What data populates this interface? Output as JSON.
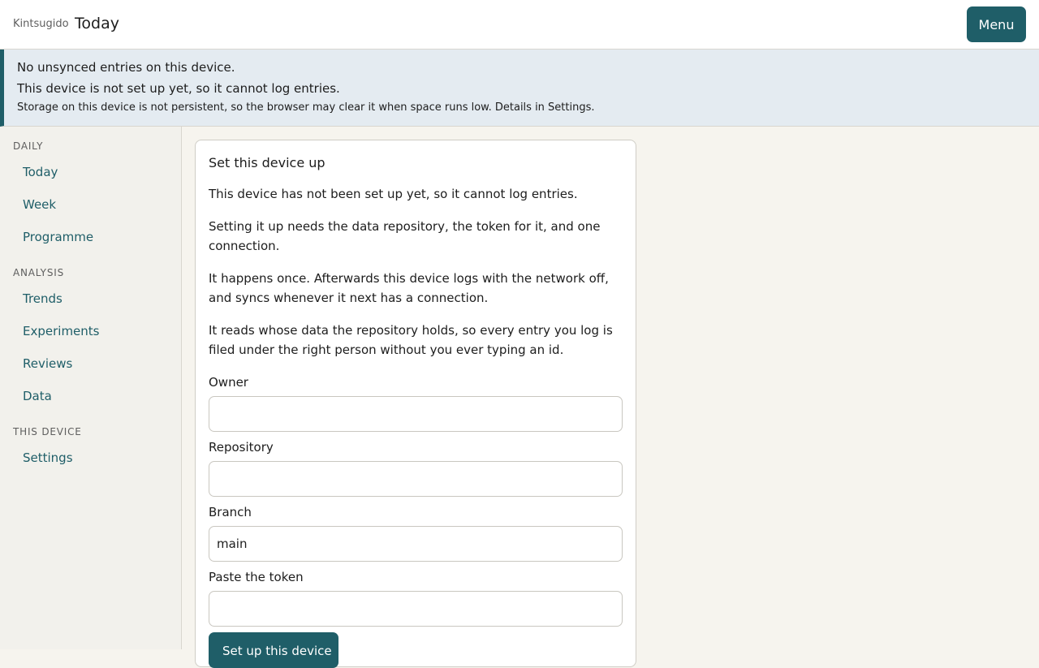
{
  "header": {
    "brand": "Kintsugido",
    "title": "Today",
    "menu_label": "Menu"
  },
  "banner": {
    "sync_status": "No unsynced entries on this device.",
    "setup_status": "This device is not set up yet, so it cannot log entries.",
    "storage_note": "Storage on this device is not persistent, so the browser may clear it when space runs low. Details in Settings."
  },
  "sidebar": {
    "sections": [
      {
        "label": "DAILY",
        "items": [
          "Today",
          "Week",
          "Programme"
        ]
      },
      {
        "label": "ANALYSIS",
        "items": [
          "Trends",
          "Experiments",
          "Reviews",
          "Data"
        ]
      },
      {
        "label": "THIS DEVICE",
        "items": [
          "Settings"
        ]
      }
    ]
  },
  "setup": {
    "title": "Set this device up",
    "paragraphs": [
      "This device has not been set up yet, so it cannot log entries.",
      "Setting it up needs the data repository, the token for it, and one connection.",
      "It happens once. Afterwards this device logs with the network off, and syncs whenever it next has a connection.",
      "It reads whose data the repository holds, so every entry you log is filed under the right person without you ever typing an id."
    ],
    "fields": {
      "owner": {
        "label": "Owner",
        "value": ""
      },
      "repository": {
        "label": "Repository",
        "value": ""
      },
      "branch": {
        "label": "Branch",
        "value": "main"
      },
      "token": {
        "label": "Paste the token",
        "value": ""
      }
    },
    "submit_label": "Set up this device"
  },
  "colors": {
    "accent": "#1f5e68",
    "banner_bg": "#e4ebf1",
    "page_bg": "#f6f4ee",
    "sidebar_bg": "#f2f1ec"
  }
}
